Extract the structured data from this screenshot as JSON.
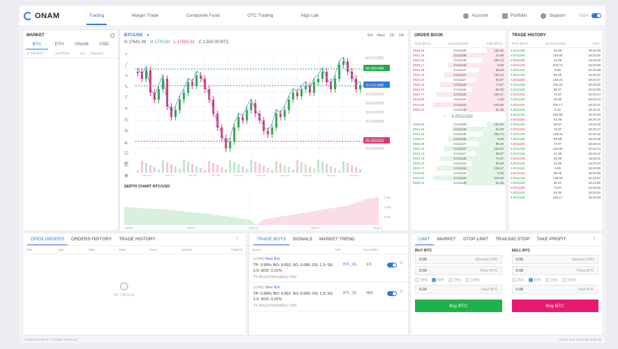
{
  "brand": {
    "name": "ONAM",
    "color": "#2c78e0"
  },
  "nav": [
    "Trading",
    "Margin Trade",
    "Composite Fund",
    "OTC Trading",
    "Algo Lab"
  ],
  "right_nav": {
    "account": "Account",
    "portfolio": "Portfolio",
    "support": "Support",
    "dark": "Dark"
  },
  "market": {
    "title": "MARKET",
    "tabs": [
      "BTC",
      "ETH",
      "ONAM",
      "USD"
    ],
    "cols": [
      "Pair BTC",
      "Last Price",
      "Vol.",
      "Change%"
    ]
  },
  "chart": {
    "pair": "BTC/USD",
    "ohlc": {
      "o": "O 17641.09",
      "h": "H 1770.00",
      "l": "L 17502.52",
      "c": "C 1,500.00 BTC"
    },
    "intervals": [
      "5m",
      "Hour",
      "1D",
      "1M"
    ],
    "price_labels": [
      "00.0011080",
      "00.0011448",
      "00.0011133",
      "00.0011000",
      "00.0010900",
      "00.0010800",
      "00.0010700",
      "00.0010600",
      "00.0010585",
      "00.0010500",
      "00.0010400"
    ],
    "time_labels": [
      "08:10",
      "08:15",
      "08:20",
      "08:25",
      "08:30",
      "08:35",
      "08:40",
      "08:45",
      "08:50",
      "08:55"
    ],
    "depth_title": "DEPTH CHART BTC/USD",
    "depth_x": [
      "7800.5",
      "7800.5",
      "7801.5",
      "7800.0",
      "7808.5"
    ],
    "depth_y": [
      "2.5M",
      "1.5M",
      "0.5M"
    ]
  },
  "orderbook": {
    "title": "ORDER BOOK",
    "cols": [
      "Price (BTC)",
      "Amount (USD)",
      "Total (BTC)"
    ],
    "asks": [
      [
        "0046.56",
        "0.011189",
        "135.00"
      ],
      [
        "0044.26",
        "0.011136",
        "21.89"
      ],
      [
        "0042.40",
        "0.011139",
        "293.74"
      ],
      [
        "0038.17",
        "0.011136",
        "8.99"
      ],
      [
        "0034.68",
        "0.011137",
        "88.49"
      ],
      [
        "0032.25",
        "0.011137",
        "139.23"
      ],
      [
        "0032.13",
        "0.011127",
        "60.97"
      ],
      [
        "0030.18",
        "0.011135",
        "72.87"
      ],
      [
        "0026.10",
        "0.011134",
        "54.00"
      ],
      [
        "0022.77",
        "0.011133",
        "229.17"
      ],
      [
        "0018.80",
        "0.011134",
        "5.25"
      ],
      [
        "0014.80",
        "0.011134",
        "610.59"
      ],
      [
        "0006.10",
        "0.011139",
        "61.48"
      ]
    ],
    "mid": "0.0011330",
    "bids": [
      [
        "0046.50",
        "0.011189",
        "135.00"
      ],
      [
        "0044.26",
        "0.011136",
        "21.89"
      ],
      [
        "0042.40",
        "0.011139",
        "293.74"
      ],
      [
        "0038.17",
        "0.011136",
        "8.99"
      ],
      [
        "0034.68",
        "0.011137",
        "88.49"
      ],
      [
        "0032.25",
        "0.011137",
        "139.23"
      ],
      [
        "0032.13",
        "0.011127",
        "60.97"
      ],
      [
        "0030.18",
        "0.011135",
        "72.87"
      ],
      [
        "0026.19",
        "0.011134",
        "54.00"
      ],
      [
        "0022.77",
        "0.011133",
        "229.17"
      ],
      [
        "0018.80",
        "0.011134",
        "5.25"
      ],
      [
        "0014.80",
        "0.011134",
        "610.59"
      ],
      [
        "0006.10",
        "0.011139",
        "61.48"
      ]
    ]
  },
  "history": {
    "title": "TRADE HISTORY",
    "cols": [
      "Price (BTC)",
      "Amount (USD)",
      "Time"
    ],
    "rows": [
      [
        "0.0011195",
        "82.88",
        "18:23:29",
        "g"
      ],
      [
        "0.0011195",
        "125.00",
        "18:23:29",
        "g"
      ],
      [
        "0.0011195",
        "21.89",
        "18:23:29",
        "r"
      ],
      [
        "0.0011195",
        "293.74",
        "18:23:28",
        "r"
      ],
      [
        "0.0011193",
        "8.89",
        "18:23:28",
        "g"
      ],
      [
        "0.0011193",
        "88.49",
        "18:23:27",
        "g"
      ],
      [
        "0.0011193",
        "139.23",
        "18:23:27",
        "r"
      ],
      [
        "0.0011188",
        "139.23",
        "18:23:26",
        "g"
      ],
      [
        "0.0011193",
        "60.97",
        "18:23:25",
        "g"
      ],
      [
        "0.0011192",
        "72.87",
        "18:23:24",
        "r"
      ],
      [
        "0.0011192",
        "54.00",
        "18:23:23",
        "g"
      ],
      [
        "0.0011192",
        "229.17",
        "18:23:22",
        "r"
      ],
      [
        "0.0011192",
        "5.25",
        "18:23:21",
        "g"
      ],
      [
        "0.0011192",
        "610.59",
        "18:23:20",
        "g"
      ],
      [
        "0.0011192",
        "61.48",
        "18:23:19",
        "r"
      ],
      [
        "0.0011192",
        "60.87",
        "18:23:18",
        "g"
      ],
      [
        "0.0011192",
        "72.87",
        "18:23:17",
        "r"
      ],
      [
        "0.0011195",
        "125.00",
        "18:23:16",
        "g"
      ],
      [
        "0.0011195",
        "82.88",
        "18:23:15",
        "g"
      ],
      [
        "0.0011192",
        "72.87",
        "18:23:14",
        "r"
      ],
      [
        "0.0011195",
        "125.00",
        "18:23:13",
        "g"
      ],
      [
        "0.0011195",
        "21.89",
        "18:23:12",
        "g"
      ],
      [
        "0.0011195",
        "82.88",
        "18:23:11",
        "r"
      ],
      [
        "0.0011195",
        "21.89",
        "18:23:10",
        "g"
      ],
      [
        "0.0011193",
        "8.89",
        "18:23:09",
        "g"
      ],
      [
        "0.0011193",
        "88.49",
        "18:23:08",
        "r"
      ],
      [
        "0.0011195",
        "139.23",
        "18:23:07",
        "g"
      ],
      [
        "0.0011193",
        "60.87",
        "18:23:06",
        "g"
      ],
      [
        "0.0011195",
        "72.87",
        "18:23:05",
        "r"
      ],
      [
        "0.0011193",
        "54.00",
        "18:23:04",
        "g"
      ],
      [
        "0.0011192",
        "229.17",
        "18:23:03",
        "g"
      ]
    ]
  },
  "orders": {
    "tabs": [
      "OPEN ORDERS",
      "ORDERS HISTORY",
      "TRADE HISTORY"
    ],
    "cols": [
      "Pair",
      "Type",
      "Side",
      "Date",
      "Price",
      "Amount",
      "Filled %"
    ],
    "empty": "NO ORDERS"
  },
  "bots": {
    "tabs": [
      "TRADE BOTS",
      "SIGNALS",
      "MARKET TREND"
    ],
    "cols": [
      "Name",
      "Pair",
      "Act Orders"
    ],
    "items": [
      {
        "side": "LONG",
        "name": "New Bot",
        "desc": "TP: 3.99%; BO: 0.002; SO: 0.006; OS: 1.3; SS: 1.0; SOS: 0.21%",
        "strategy": "TV-BuyOrStrongBuy-15m",
        "pair": "BTL_DL",
        "orders": "1/1"
      },
      {
        "side": "LONG",
        "name": "New Bot",
        "desc": "TP: 3.99%; BO: 0.002; SO: 0.006; OS: 1.3; SS: 1.0; SOS: 0.21%",
        "strategy": "TV-BuyOrStrongBuy-15m",
        "pair": "BTL_DL",
        "orders": "N/O"
      }
    ]
  },
  "trade": {
    "tabs": [
      "LIMIT",
      "MARKET",
      "STOP-LIMIT",
      "TRAILING STOP",
      "TAKE PROFIT"
    ],
    "buy_title": "BUY BTC",
    "sell_title": "SELL BTC",
    "amount_label": "Amount USD",
    "price_label": "Price BTC",
    "total_label": "Total BTC",
    "zero": "0.00",
    "pcts": [
      "25%",
      "50%",
      "25%",
      "100%"
    ],
    "buy_btn": "Buy BTC",
    "sell_btn": "Buy BTC",
    "buy_color": "#1fb24a",
    "sell_color": "#e8196f"
  },
  "footer": {
    "left": "© 2020 ONAM Inc All Rights Reserved",
    "right": "Server time 12:28:00 15:28:15"
  }
}
